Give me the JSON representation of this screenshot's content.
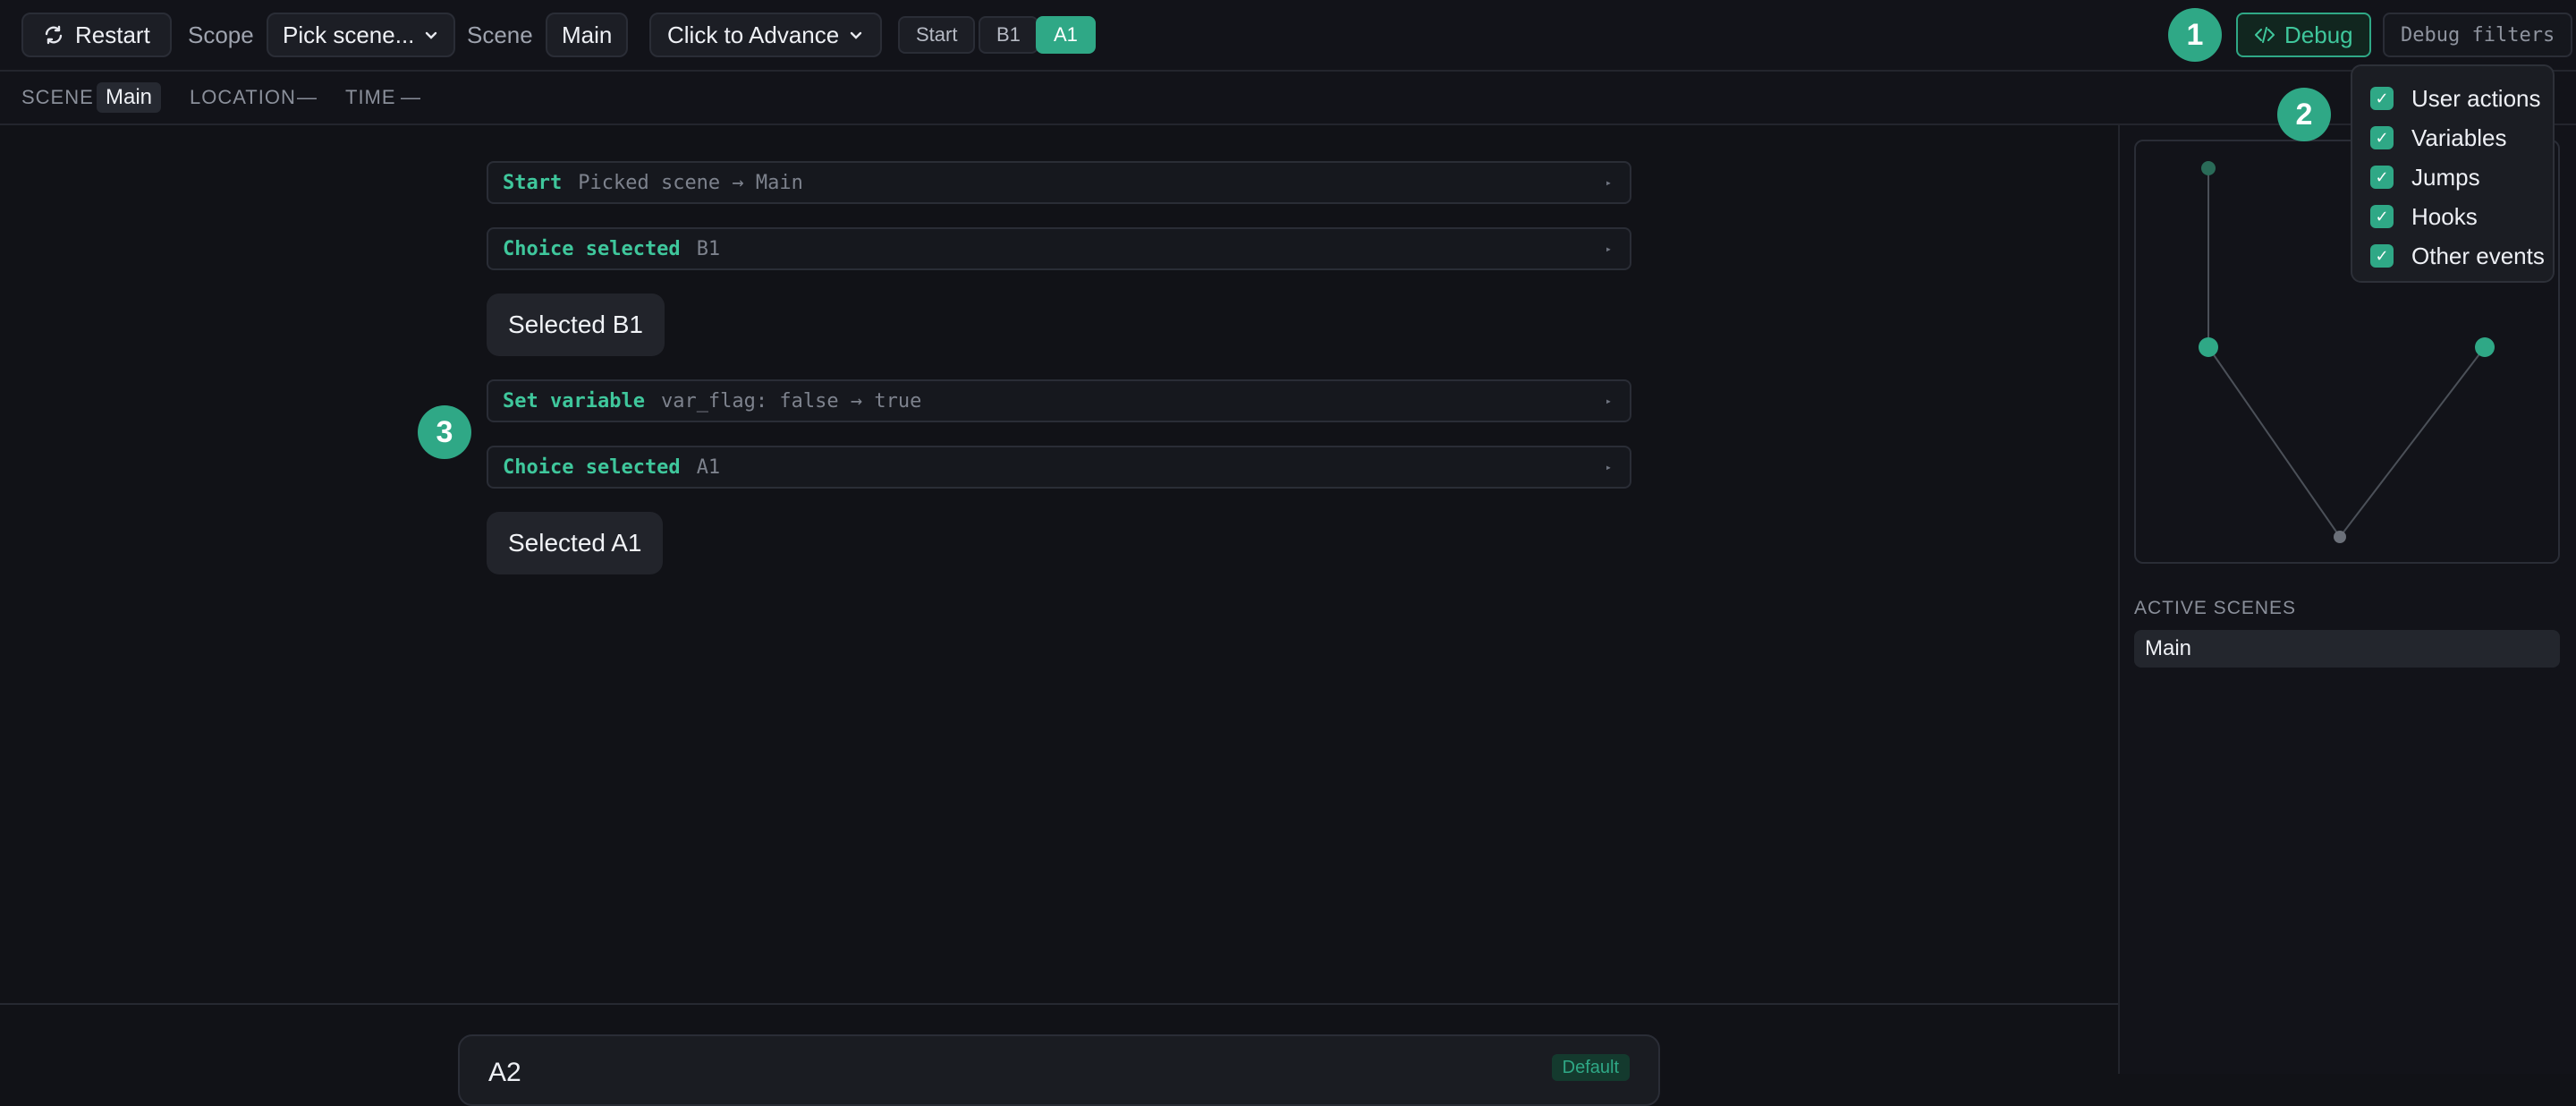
{
  "toolbar": {
    "restart_label": "Restart",
    "scope_label": "Scope",
    "scope_value": "Pick scene...",
    "scene_label": "Scene",
    "scene_value": "Main",
    "advance_mode": "Click to Advance",
    "pills": [
      "Start",
      "B1",
      "A1"
    ],
    "active_pill": "A1",
    "debug_label": "Debug",
    "filters_label": "Debug filters"
  },
  "markers": [
    "1",
    "2",
    "3"
  ],
  "status": {
    "scene_label": "SCENE",
    "scene_value": "Main",
    "location_label": "LOCATION",
    "location_value": "—",
    "time_label": "TIME",
    "time_value": "—"
  },
  "log": [
    {
      "type": "Start",
      "detail": "Picked scene → Main"
    },
    {
      "type": "Choice selected",
      "detail": "B1"
    },
    {
      "bubble": "Selected B1"
    },
    {
      "type": "Set variable",
      "detail": "var_flag: false → true"
    },
    {
      "type": "Choice selected",
      "detail": "A1"
    },
    {
      "bubble": "Selected A1"
    }
  ],
  "filters": [
    "User actions",
    "Variables",
    "Jumps",
    "Hooks",
    "Other events"
  ],
  "active_scenes": {
    "title": "ACTIVE SCENES",
    "items": [
      "Main"
    ]
  },
  "bottom_card": {
    "name": "A2",
    "tag": "Default"
  },
  "colors": {
    "accent": "#2fa886",
    "background": "#111217",
    "panel": "#16181e"
  }
}
